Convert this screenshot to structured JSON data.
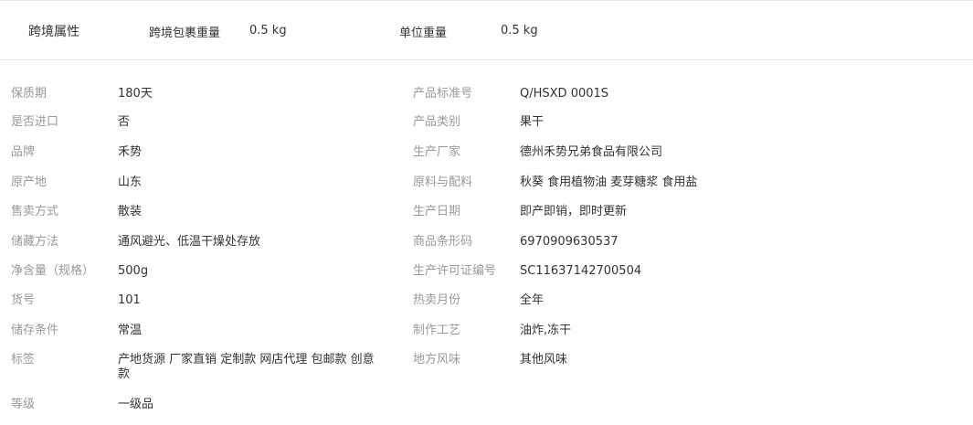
{
  "cross_border": {
    "title": "跨境属性",
    "package_weight_label": "跨境包裹重量",
    "package_weight_value": "0.5 kg",
    "unit_weight_label": "单位重量",
    "unit_weight_value": "0.5 kg"
  },
  "attributes_left": [
    {
      "label": "保质期",
      "value": "180天"
    },
    {
      "label": "是否进口",
      "value": "否"
    },
    {
      "label": "品牌",
      "value": "禾势"
    },
    {
      "label": "原产地",
      "value": "山东"
    },
    {
      "label": "售卖方式",
      "value": "散装"
    },
    {
      "label": "储藏方法",
      "value": "通风避光、低温干燥处存放"
    },
    {
      "label": "净含量（规格）",
      "value": "500g"
    },
    {
      "label": "货号",
      "value": "101"
    },
    {
      "label": "储存条件",
      "value": "常温"
    },
    {
      "label": "标签",
      "value": "产地货源 厂家直销 定制款 网店代理 包邮款 创意款"
    },
    {
      "label": "等级",
      "value": "一级品"
    }
  ],
  "attributes_right": [
    {
      "label": "产品标准号",
      "value": "Q/HSXD 0001S"
    },
    {
      "label": "产品类别",
      "value": "果干"
    },
    {
      "label": "生产厂家",
      "value": "德州禾势兄弟食品有限公司"
    },
    {
      "label": "原料与配料",
      "value": "秋葵 食用植物油 麦芽糖浆 食用盐"
    },
    {
      "label": "生产日期",
      "value": "即产即销，即时更新"
    },
    {
      "label": "商品条形码",
      "value": "6970909630537"
    },
    {
      "label": "生产许可证编号",
      "value": "SC11637142700504"
    },
    {
      "label": "热卖月份",
      "value": "全年"
    },
    {
      "label": "制作工艺",
      "value": "油炸,冻干"
    },
    {
      "label": "地方风味",
      "value": "其他风味"
    }
  ]
}
